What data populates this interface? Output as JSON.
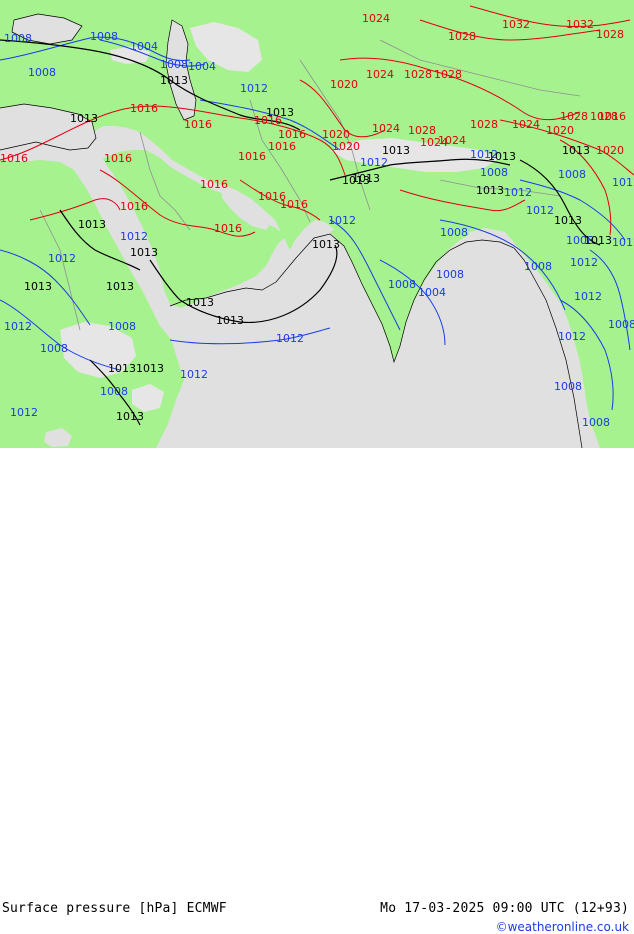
{
  "title": "Surface pressure [hPa] ECMWF",
  "valid_time": "Mo 17-03-2025 09:00 UTC (12+93)",
  "credit": "©weatheronline.co.uk",
  "colors": {
    "land": "#a6f28f",
    "sea": "#e0e0e0",
    "highland": "#e6e6e6",
    "isobar_high": "#e0000f",
    "isobar_low": "#1a3ce6",
    "isobar_ref": "#000000",
    "credit": "#1a3ce6"
  },
  "isobar_labels": [
    {
      "text": "1024",
      "cls": "high"
    },
    {
      "text": "1028",
      "cls": "high"
    },
    {
      "text": "1032",
      "cls": "high"
    },
    {
      "text": "1032",
      "cls": "high"
    },
    {
      "text": "1028",
      "cls": "high"
    },
    {
      "text": "1028",
      "cls": "high"
    },
    {
      "text": "1020",
      "cls": "high"
    },
    {
      "text": "1024",
      "cls": "high"
    },
    {
      "text": "1028",
      "cls": "high"
    },
    {
      "text": "1016",
      "cls": "high"
    },
    {
      "text": "1016",
      "cls": "high"
    },
    {
      "text": "1016",
      "cls": "high"
    },
    {
      "text": "1016",
      "cls": "high"
    },
    {
      "text": "1020",
      "cls": "high"
    },
    {
      "text": "1024",
      "cls": "high"
    },
    {
      "text": "1028",
      "cls": "high"
    },
    {
      "text": "1024",
      "cls": "high"
    },
    {
      "text": "1028",
      "cls": "high"
    },
    {
      "text": "1024",
      "cls": "high"
    },
    {
      "text": "1020",
      "cls": "high"
    },
    {
      "text": "1028",
      "cls": "high"
    },
    {
      "text": "1016",
      "cls": "high"
    },
    {
      "text": "1016",
      "cls": "high"
    },
    {
      "text": "1016",
      "cls": "high"
    },
    {
      "text": "1016",
      "cls": "high"
    },
    {
      "text": "1016",
      "cls": "high"
    },
    {
      "text": "1016",
      "cls": "high"
    },
    {
      "text": "1016",
      "cls": "high"
    },
    {
      "text": "1016",
      "cls": "high"
    },
    {
      "text": "1016",
      "cls": "high"
    },
    {
      "text": "1020",
      "cls": "high"
    },
    {
      "text": "1024",
      "cls": "high"
    },
    {
      "text": "1028",
      "cls": "high"
    },
    {
      "text": "1016",
      "cls": "high"
    },
    {
      "text": "1020",
      "cls": "high"
    },
    {
      "text": "1008",
      "cls": "low"
    },
    {
      "text": "1004",
      "cls": "low"
    },
    {
      "text": "1008",
      "cls": "low"
    },
    {
      "text": "1008",
      "cls": "low"
    },
    {
      "text": "1004",
      "cls": "low"
    },
    {
      "text": "1012",
      "cls": "low"
    },
    {
      "text": "1012",
      "cls": "low"
    },
    {
      "text": "1012",
      "cls": "low"
    },
    {
      "text": "1012",
      "cls": "low"
    },
    {
      "text": "1012",
      "cls": "low"
    },
    {
      "text": "1012",
      "cls": "low"
    },
    {
      "text": "1012",
      "cls": "low"
    },
    {
      "text": "1012",
      "cls": "low"
    },
    {
      "text": "1012",
      "cls": "low"
    },
    {
      "text": "1008",
      "cls": "low"
    },
    {
      "text": "1008",
      "cls": "low"
    },
    {
      "text": "1008",
      "cls": "low"
    },
    {
      "text": "1008",
      "cls": "low"
    },
    {
      "text": "1008",
      "cls": "low"
    },
    {
      "text": "1008",
      "cls": "low"
    },
    {
      "text": "1004",
      "cls": "low"
    },
    {
      "text": "1008",
      "cls": "low"
    },
    {
      "text": "1012",
      "cls": "low"
    },
    {
      "text": "1012",
      "cls": "low"
    },
    {
      "text": "1008",
      "cls": "low"
    },
    {
      "text": "1012",
      "cls": "low"
    },
    {
      "text": "1008",
      "cls": "low"
    },
    {
      "text": "1008",
      "cls": "low"
    },
    {
      "text": "1012",
      "cls": "low"
    },
    {
      "text": "1012",
      "cls": "low"
    },
    {
      "text": "1008",
      "cls": "low"
    },
    {
      "text": "1012",
      "cls": "low"
    },
    {
      "text": "1008",
      "cls": "low"
    },
    {
      "text": "1008",
      "cls": "low"
    },
    {
      "text": "1012",
      "cls": "low"
    },
    {
      "text": "1012",
      "cls": "low"
    },
    {
      "text": "1008",
      "cls": "low"
    },
    {
      "text": "1013",
      "cls": "ref"
    },
    {
      "text": "1013",
      "cls": "ref"
    },
    {
      "text": "1013",
      "cls": "ref"
    },
    {
      "text": "1013",
      "cls": "ref"
    },
    {
      "text": "1013",
      "cls": "ref"
    },
    {
      "text": "1013",
      "cls": "ref"
    },
    {
      "text": "1013",
      "cls": "ref"
    },
    {
      "text": "1013",
      "cls": "ref"
    },
    {
      "text": "1013",
      "cls": "ref"
    },
    {
      "text": "1013",
      "cls": "ref"
    },
    {
      "text": "1013",
      "cls": "ref"
    },
    {
      "text": "1013",
      "cls": "ref"
    },
    {
      "text": "1013",
      "cls": "ref"
    },
    {
      "text": "1013",
      "cls": "ref"
    },
    {
      "text": "1013",
      "cls": "ref"
    },
    {
      "text": "1013",
      "cls": "ref"
    },
    {
      "text": "1013",
      "cls": "ref"
    },
    {
      "text": "1013",
      "cls": "ref"
    },
    {
      "text": "1013",
      "cls": "ref"
    },
    {
      "text": "1013",
      "cls": "ref"
    },
    {
      "text": "1013",
      "cls": "ref"
    },
    {
      "text": "1013",
      "cls": "ref"
    }
  ]
}
